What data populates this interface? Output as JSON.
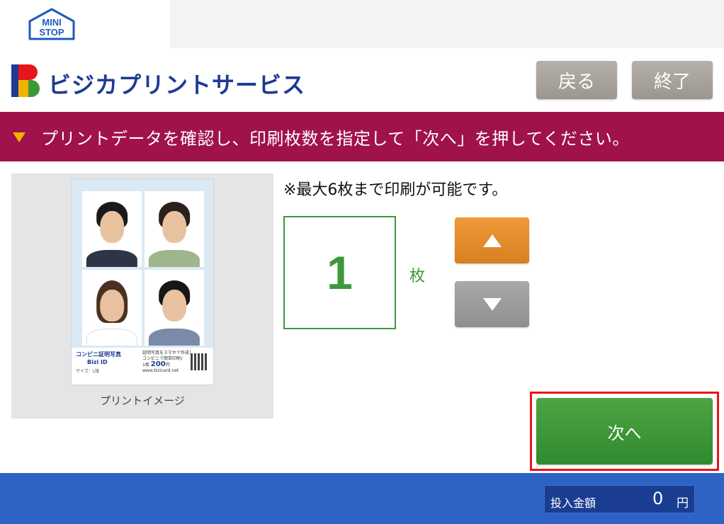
{
  "store": {
    "logo_text_1": "MINI",
    "logo_text_2": "STOP"
  },
  "service": {
    "title": "ビジカプリントサービス"
  },
  "header_buttons": {
    "back": "戻る",
    "end": "終了"
  },
  "instruction": "プリントデータを確認し、印刷枚数を指定して「次へ」を押してください。",
  "preview": {
    "caption": "プリントイメージ",
    "sheet_title": "コンビニ証明写真",
    "sheet_sub": "Bizi ID",
    "sheet_note": "サイズ：L版",
    "sheet_right_1": "証明写真をスマホで作成！",
    "sheet_right_2": "コンビニで簡単印刷♪",
    "sheet_price": "200",
    "sheet_price_prefix": "1枚",
    "sheet_price_unit": "円",
    "sheet_url": "www.bizicard.net"
  },
  "quantity": {
    "max_note": "※最大6枚まで印刷が可能です。",
    "value": "1",
    "unit": "枚"
  },
  "next_button": "次へ",
  "payment": {
    "label": "投入金額",
    "value": "0",
    "unit": "円"
  },
  "colors": {
    "banner": "#a0124b",
    "accent_green": "#3a9a3a",
    "footer": "#2e63c6",
    "highlight": "#e8151b",
    "brand_blue": "#1f3a93"
  }
}
